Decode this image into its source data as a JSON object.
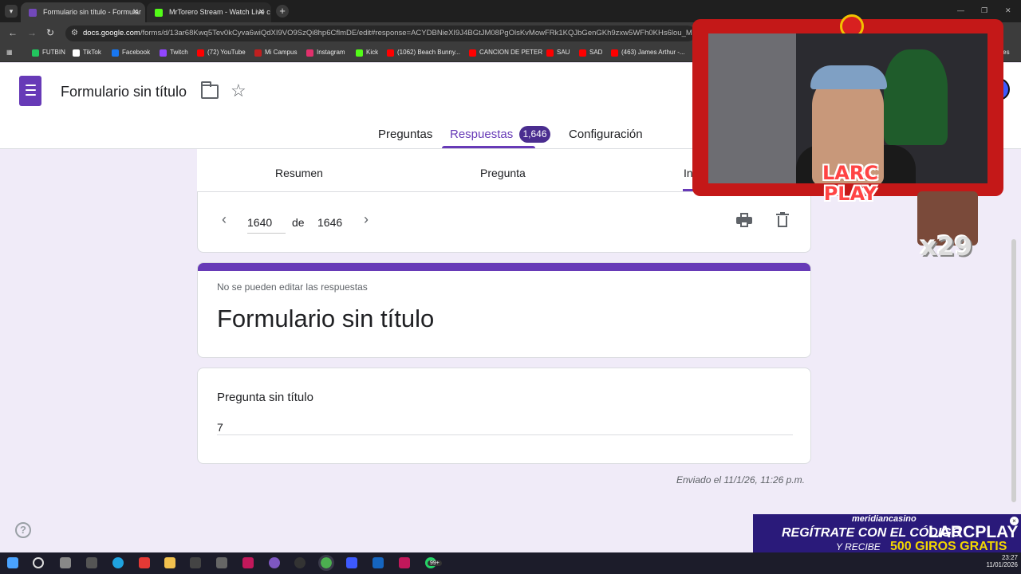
{
  "browser": {
    "tabs": [
      {
        "label": "Formulario sin título - Formular",
        "favicon_color": "#7248b9"
      },
      {
        "label": "MrTorero Stream - Watch Live c",
        "favicon_color": "#53fc18"
      }
    ],
    "url_domain": "docs.google.com",
    "url_path": "/forms/d/13ar68Kwq5Tev0kCyva6wiQdXI9VO9SzQi8hp6CflmDE/edit#response=ACYDBNieXI9J4BGtJM08PgOlsKvMowFRk1KQJbGenGKh9zxw5WFh0KHs6lou_Mkfd6_O9z8",
    "bookmarks": [
      {
        "label": "FUTBIN",
        "color": "#22c55e"
      },
      {
        "label": "TikTok",
        "color": "#ffffff"
      },
      {
        "label": "Facebook",
        "color": "#1877f2"
      },
      {
        "label": "Twitch",
        "color": "#9146ff"
      },
      {
        "label": "(72) YouTube",
        "color": "#ff0000"
      },
      {
        "label": "Mi Campus",
        "color": "#c02020"
      },
      {
        "label": "Instagram",
        "color": "#e1306c"
      },
      {
        "label": "Kick",
        "color": "#53fc18"
      },
      {
        "label": "(1062) Beach Bunny...",
        "color": "#ff0000"
      },
      {
        "label": "CANCION DE PETER",
        "color": "#ff0000"
      },
      {
        "label": "SAU",
        "color": "#ff0000"
      },
      {
        "label": "SAD",
        "color": "#ff0000"
      },
      {
        "label": "(463) James Arthur -...",
        "color": "#ff0000"
      }
    ],
    "bookmarks_overflow": "ores"
  },
  "forms": {
    "title": "Formulario sin título",
    "tabs": {
      "questions": "Preguntas",
      "responses": "Respuestas",
      "settings": "Configuración"
    },
    "responses_count": "1,646",
    "subtabs": {
      "summary": "Resumen",
      "question": "Pregunta",
      "individual": "In"
    },
    "pager": {
      "current": "1640",
      "of": "de",
      "total": "1646"
    },
    "response": {
      "notice": "No se pueden editar las respuestas",
      "form_title": "Formulario sin título",
      "question_title": "Pregunta sin título",
      "answer": "7",
      "submitted": "Enviado el 11/1/26, 11:26 p.m."
    },
    "colors": {
      "accent": "#673ab7",
      "background": "#f0ebf8"
    }
  },
  "overlay": {
    "logo_line1": "LARC",
    "logo_line2": "PLAY",
    "multiplier": "x29",
    "ad": {
      "brand": "meridiancasino",
      "line1": "REGÍTRATE CON EL CÓDIGO",
      "code": "LARCPLAY",
      "line2": "Y RECIBE",
      "spins": "500 GIROS GRATIS"
    }
  },
  "taskbar": {
    "badge": "99+",
    "time": "23:27",
    "date": "11/01/2026"
  }
}
